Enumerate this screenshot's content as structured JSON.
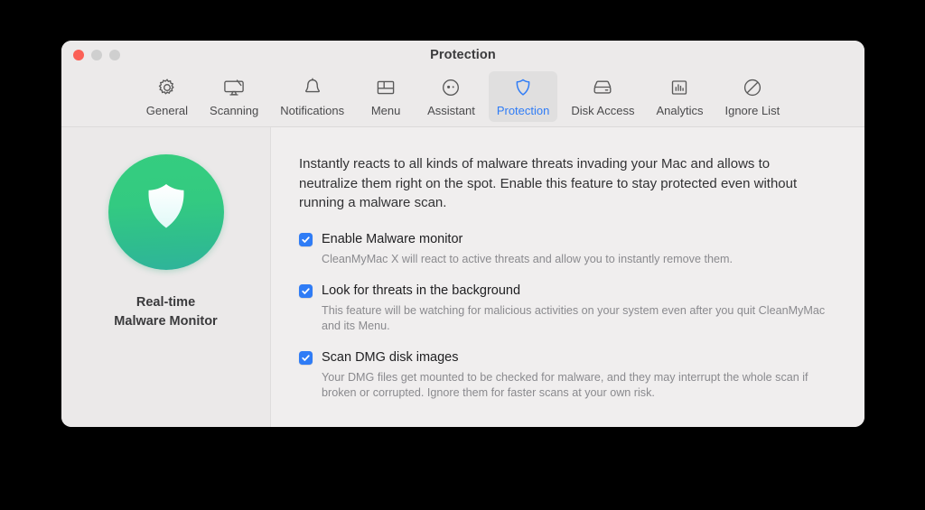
{
  "window": {
    "title": "Protection",
    "traffic_lights": [
      {
        "name": "close",
        "color": "#fb6056"
      },
      {
        "name": "minimize",
        "color": "#cfcfcf"
      },
      {
        "name": "zoom",
        "color": "#cfcfcf"
      }
    ]
  },
  "toolbar": {
    "selected": "Protection",
    "accent_color": "#2f7cf6",
    "tabs": [
      {
        "label": "General",
        "icon": "gear-icon"
      },
      {
        "label": "Scanning",
        "icon": "display-scan-icon"
      },
      {
        "label": "Notifications",
        "icon": "bell-icon"
      },
      {
        "label": "Menu",
        "icon": "menu-layout-icon"
      },
      {
        "label": "Assistant",
        "icon": "assistant-face-icon"
      },
      {
        "label": "Protection",
        "icon": "shield-icon"
      },
      {
        "label": "Disk Access",
        "icon": "hard-drive-icon"
      },
      {
        "label": "Analytics",
        "icon": "bar-chart-icon"
      },
      {
        "label": "Ignore List",
        "icon": "prohibition-icon"
      }
    ]
  },
  "sidebar": {
    "icon": "shield-badge-icon",
    "icon_gradient_from": "#35cd7f",
    "icon_gradient_to": "#2fb39b",
    "caption_line1": "Real-time",
    "caption_line2": "Malware Monitor"
  },
  "main": {
    "intro": "Instantly reacts to all kinds of malware threats invading your Mac and allows to neutralize them right on the spot. Enable this feature to stay protected even without running a malware scan.",
    "options": [
      {
        "checked": true,
        "title": "Enable Malware monitor",
        "description": "CleanMyMac X will react to active threats and allow you to instantly remove them."
      },
      {
        "checked": true,
        "title": "Look for threats in the background",
        "description": "This feature will be watching for malicious activities on your system even after you quit CleanMyMac and its Menu."
      },
      {
        "checked": true,
        "title": "Scan DMG disk images",
        "description": "Your DMG files get mounted to be checked for malware, and they may interrupt the whole scan if broken or corrupted. Ignore them for faster scans at your own risk."
      }
    ]
  }
}
